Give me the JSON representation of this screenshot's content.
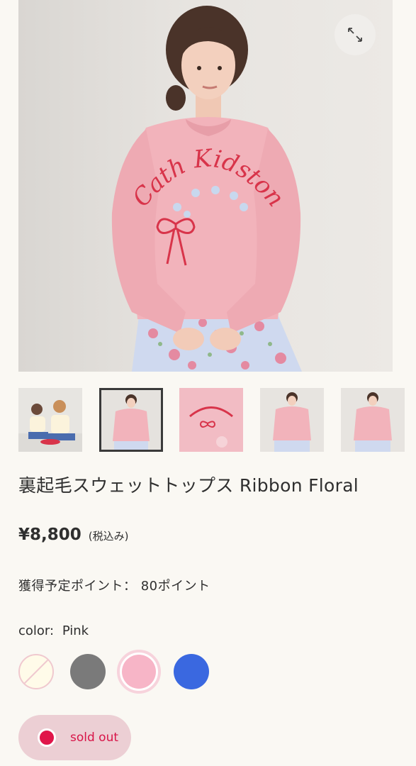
{
  "product": {
    "title": "裏起毛スウェットトップス Ribbon Floral",
    "price": "¥8,800",
    "tax_note": "(税込み)",
    "points_label": "獲得予定ポイント：",
    "points_value": "80ポイント",
    "color_label": "color:",
    "color_value": "Pink",
    "print_text": "Cath Kidston"
  },
  "gallery": {
    "expand_icon": "expand-icon",
    "thumbnails": [
      {
        "name": "thumb-two-models",
        "active": false
      },
      {
        "name": "thumb-model-front",
        "active": true
      },
      {
        "name": "thumb-flat-lay",
        "active": false
      },
      {
        "name": "thumb-model-front-2",
        "active": false
      },
      {
        "name": "thumb-model-side",
        "active": false
      }
    ]
  },
  "swatches": [
    {
      "name": "cream",
      "color": "#fffbe9",
      "available": false
    },
    {
      "name": "gray",
      "color": "#7a7a7a",
      "available": true
    },
    {
      "name": "pink",
      "color": "#f7b5c7",
      "available": true,
      "selected": true
    },
    {
      "name": "blue",
      "color": "#3a68e0",
      "available": true
    }
  ],
  "stock": {
    "status_label": "sold out",
    "dot_color": "#e0164a"
  },
  "colors": {
    "background": "#faf8f3",
    "sweater": "#f2b3bb",
    "soldout_bg": "#eccfd4",
    "soldout_text": "#d81448"
  }
}
